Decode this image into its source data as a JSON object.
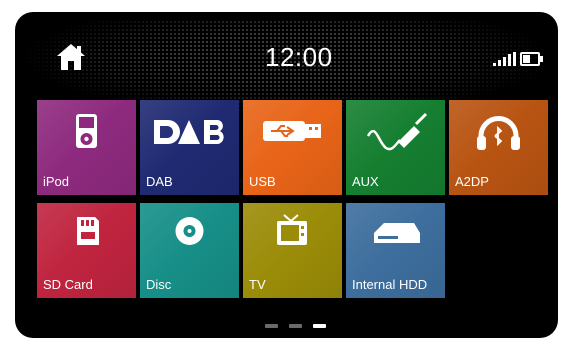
{
  "status": {
    "time": "12:00",
    "signal_level": 5,
    "battery_level": 0.5
  },
  "tiles": [
    {
      "label": "iPod",
      "icon": "ipod-icon",
      "color": "#8e2a7e"
    },
    {
      "label": "DAB",
      "icon": "dab-logo-icon",
      "color": "#1f2a72"
    },
    {
      "label": "USB",
      "icon": "usb-icon",
      "color": "#e86418"
    },
    {
      "label": "AUX",
      "icon": "aux-cable-icon",
      "color": "#157f30"
    },
    {
      "label": "A2DP",
      "icon": "bluetooth-headphones-icon",
      "color": "#b85412"
    },
    {
      "label": "SD Card",
      "icon": "sd-card-icon",
      "color": "#c0243f"
    },
    {
      "label": "Disc",
      "icon": "disc-icon",
      "color": "#168f88"
    },
    {
      "label": "TV",
      "icon": "tv-icon",
      "color": "#9b8c08"
    },
    {
      "label": "Internal HDD",
      "icon": "hdd-icon",
      "color": "#3d6e9d"
    }
  ],
  "pagination": {
    "pages": 3,
    "active_page": 3
  },
  "colors": {
    "screen_bg": "#000000",
    "dot_inactive": "#6a6a6a",
    "dot_active": "#ffffff"
  }
}
